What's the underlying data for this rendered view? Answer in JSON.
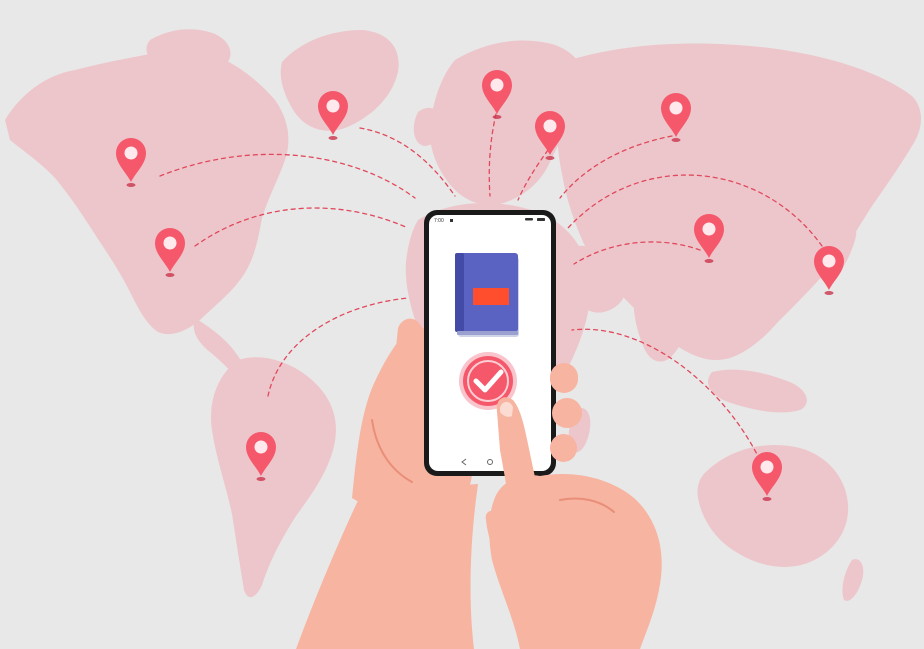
{
  "colors": {
    "background": "#e8e8e8",
    "continent": "#edc6cb",
    "pin": "#f5586b",
    "pin_dark": "#c9354c",
    "route": "#e0495c",
    "phone_body": "#1a1a1a",
    "phone_screen": "#ffffff",
    "book_cover": "#5b63c2",
    "book_label": "#ff4e2e",
    "check_badge": "#f5586b",
    "skin": "#f7b4a0",
    "skin_shadow": "#e88e79"
  },
  "phone": {
    "status_time": "7:00"
  },
  "icons": {
    "pins": "map-pin-icon",
    "book": "book-icon",
    "check": "checkmark-icon"
  }
}
